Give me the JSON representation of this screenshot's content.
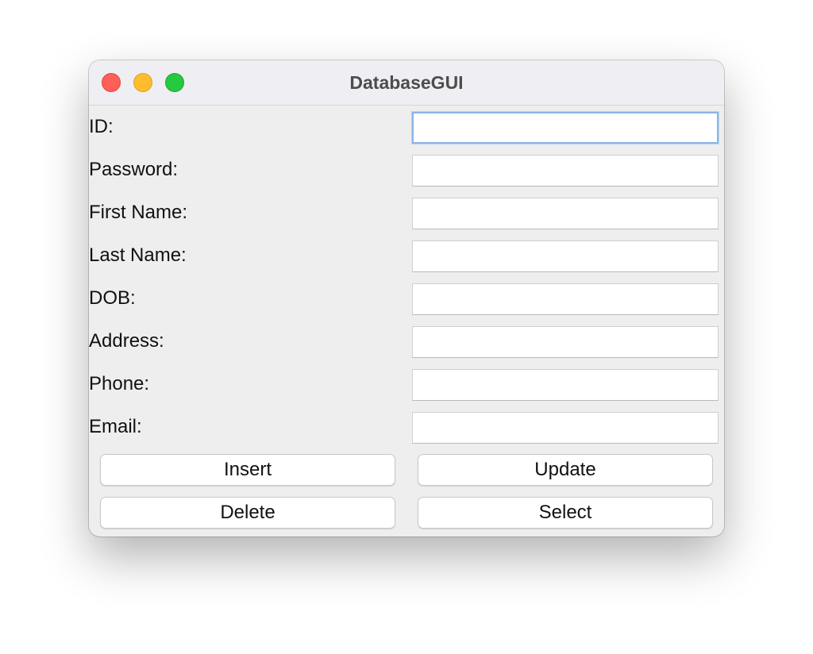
{
  "window": {
    "title": "DatabaseGUI"
  },
  "form": {
    "fields": [
      {
        "label": "ID:",
        "value": "",
        "focused": true
      },
      {
        "label": "Password:",
        "value": ""
      },
      {
        "label": "First Name:",
        "value": ""
      },
      {
        "label": "Last Name:",
        "value": ""
      },
      {
        "label": "DOB:",
        "value": ""
      },
      {
        "label": "Address:",
        "value": ""
      },
      {
        "label": "Phone:",
        "value": ""
      },
      {
        "label": "Email:",
        "value": ""
      }
    ]
  },
  "buttons": {
    "insert": "Insert",
    "update": "Update",
    "delete": "Delete",
    "select": "Select"
  },
  "colors": {
    "close": "#fe5f57",
    "minimize": "#febc2e",
    "zoom": "#28c840",
    "focus_ring": "#8cb4e6"
  }
}
